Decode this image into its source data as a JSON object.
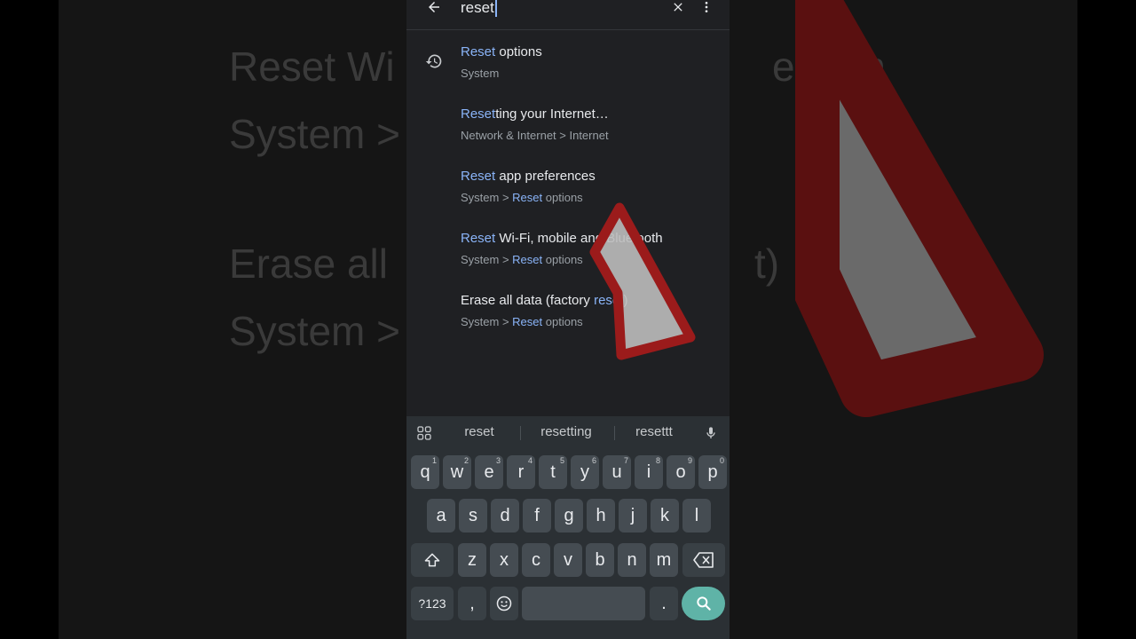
{
  "background": {
    "line1": "Reset Wi",
    "line1_right": "etooth",
    "line2": "System >",
    "line3": "Erase all",
    "line3_right": "t)",
    "line4": "System >"
  },
  "search": {
    "query": "reset",
    "back_icon": "arrow-back-icon",
    "clear_icon": "close-icon",
    "menu_icon": "more-vert-icon"
  },
  "results": [
    {
      "title_hl": "Reset",
      "title_rest": " options",
      "subtitle": "System",
      "icon": "history-icon"
    },
    {
      "title_hl": "Reset",
      "title_rest": "ting your Internet…",
      "subtitle": "Network & Internet > Internet"
    },
    {
      "title_hl": "Reset",
      "title_rest": " app preferences",
      "sub_pre": "System > ",
      "sub_hl": "Reset",
      "sub_post": " options"
    },
    {
      "title_hl": "Reset",
      "title_rest": " Wi-Fi, mobile and Bluetooth",
      "sub_pre": "System > ",
      "sub_hl": "Reset",
      "sub_post": " options"
    },
    {
      "title_pre": "Erase all data (factory ",
      "title_hl": "reset",
      "title_post": ")",
      "sub_pre": "System > ",
      "sub_hl": "Reset",
      "sub_post": " options"
    }
  ],
  "keyboard": {
    "suggestions": [
      "reset",
      "resetting",
      "resettt"
    ],
    "row1": [
      "q",
      "w",
      "e",
      "r",
      "t",
      "y",
      "u",
      "i",
      "o",
      "p"
    ],
    "row1_hints": [
      "1",
      "2",
      "3",
      "4",
      "5",
      "6",
      "7",
      "8",
      "9",
      "0"
    ],
    "row2": [
      "a",
      "s",
      "d",
      "f",
      "g",
      "h",
      "j",
      "k",
      "l"
    ],
    "row3": [
      "z",
      "x",
      "c",
      "v",
      "b",
      "n",
      "m"
    ],
    "symbols_label": "?123",
    "comma": ",",
    "period": ".",
    "accent_color": "#5fb3a7"
  }
}
